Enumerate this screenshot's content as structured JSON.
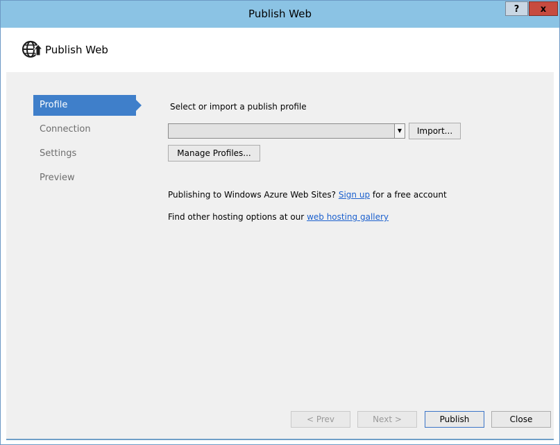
{
  "window": {
    "title": "Publish Web",
    "help_label": "?",
    "close_label": "x"
  },
  "header": {
    "title": "Publish Web",
    "icon": "globe-arrow-icon"
  },
  "sidebar": {
    "items": [
      {
        "label": "Profile",
        "active": true
      },
      {
        "label": "Connection",
        "active": false
      },
      {
        "label": "Settings",
        "active": false
      },
      {
        "label": "Preview",
        "active": false
      }
    ]
  },
  "main": {
    "select_label": "Select or import a publish profile",
    "profile_select": {
      "value": ""
    },
    "import_label": "Import...",
    "manage_label": "Manage Profiles...",
    "azure_prefix": "Publishing to Windows Azure Web Sites?",
    "azure_link": "Sign up",
    "azure_suffix": "for a free account",
    "hosting_prefix": "Find other hosting options at our",
    "hosting_link": "web hosting gallery"
  },
  "footer": {
    "prev_label": "< Prev",
    "next_label": "Next >",
    "publish_label": "Publish",
    "close_label": "Close"
  },
  "colors": {
    "titlebar": "#8bc3e4",
    "accent": "#3f7fca",
    "link": "#1b60ce",
    "close_button": "#c74b3f"
  }
}
